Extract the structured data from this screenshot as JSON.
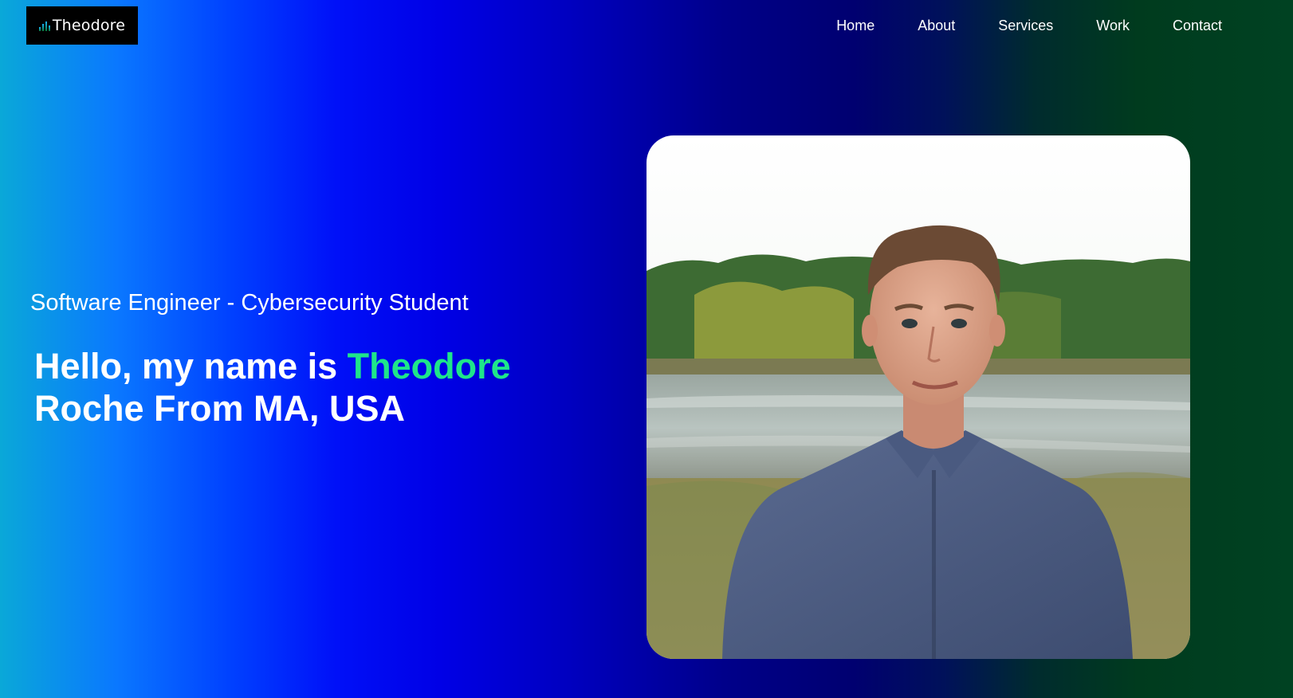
{
  "brand": {
    "logo_text": "Theodore"
  },
  "nav": {
    "items": [
      {
        "label": "Home"
      },
      {
        "label": "About"
      },
      {
        "label": "Services"
      },
      {
        "label": "Work"
      },
      {
        "label": "Contact"
      }
    ]
  },
  "hero": {
    "subtitle": "Software Engineer - Cybersecurity Student",
    "headline_prefix": "Hello, my name is ",
    "headline_name": "Theodore",
    "headline_suffix": " Roche From MA, USA"
  },
  "colors": {
    "accent": "#1ee68a",
    "text": "#ffffff",
    "logo_bg": "#000000"
  }
}
